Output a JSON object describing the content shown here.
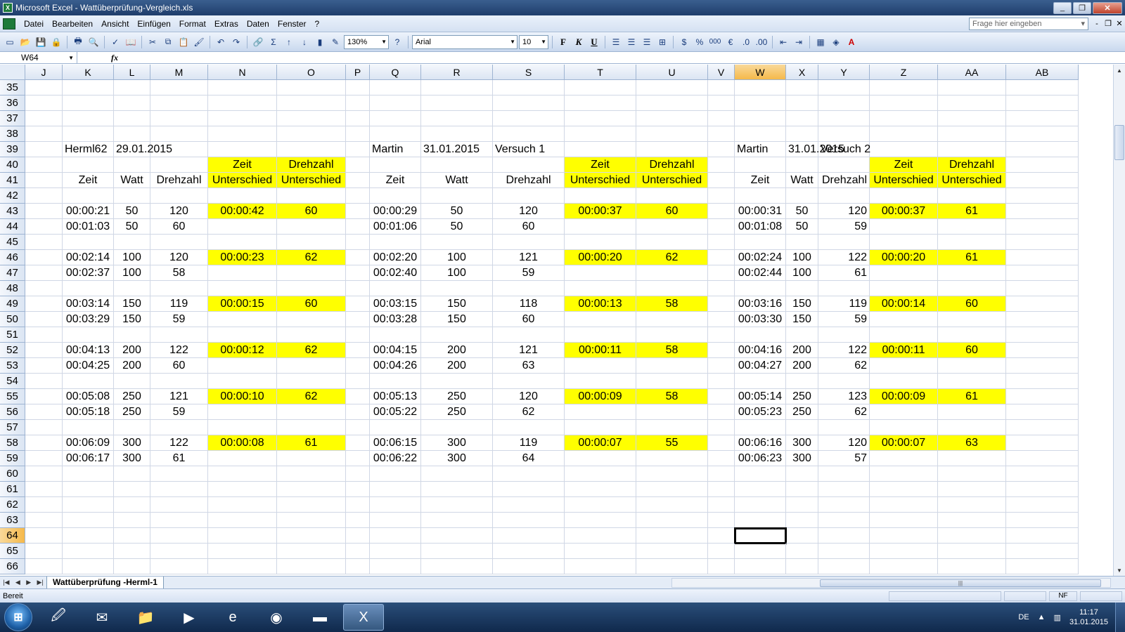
{
  "window": {
    "title": "Microsoft Excel - Wattüberprüfung-Vergleich.xls",
    "app_icon": "X",
    "buttons": [
      "_",
      "❐",
      "✕"
    ]
  },
  "menu": {
    "items": [
      "Datei",
      "Bearbeiten",
      "Ansicht",
      "Einfügen",
      "Format",
      "Extras",
      "Daten",
      "Fenster",
      "?"
    ],
    "help_placeholder": "Frage hier eingeben",
    "controls": [
      "-",
      "❐",
      "✕"
    ]
  },
  "toolbar": {
    "zoom": "130%",
    "font": "Arial",
    "size": "10",
    "bold": "F",
    "italic": "K",
    "underline": "U",
    "percent": "%",
    "thousands": "000",
    "euro": "€",
    "sum": "Σ",
    "fontcolor": "A"
  },
  "formula": {
    "namebox": "W64",
    "fx": "fx",
    "value": ""
  },
  "columns": [
    "J",
    "K",
    "L",
    "M",
    "N",
    "O",
    "P",
    "Q",
    "R",
    "S",
    "T",
    "U",
    "V",
    "W",
    "X",
    "Y",
    "Z",
    "AA",
    "AB"
  ],
  "active_column": "W",
  "active_row": "64",
  "rows": [
    {
      "n": "35",
      "cells": {}
    },
    {
      "n": "36",
      "cells": {}
    },
    {
      "n": "37",
      "cells": {}
    },
    {
      "n": "38",
      "cells": {}
    },
    {
      "n": "39",
      "cells": {
        "K": "Herml62",
        "L": "29.01.2015",
        "Q": "Martin",
        "R": "31.01.2015",
        "S": "Versuch 1",
        "W": "Martin",
        "X": "31.01.2015",
        "Y": "Versuch 2"
      }
    },
    {
      "n": "40",
      "cells": {
        "N": "Zeit",
        "O": "Drehzahl",
        "T": "Zeit",
        "U": "Drehzahl",
        "Z": "Zeit",
        "AA": "Drehzahl"
      }
    },
    {
      "n": "41",
      "cells": {
        "K": "Zeit",
        "L": "Watt",
        "M": "Drehzahl",
        "N": "Unterschied",
        "O": "Unterschied",
        "Q": "Zeit",
        "R": "Watt",
        "S": "Drehzahl",
        "T": "Unterschied",
        "U": "Unterschied",
        "W": "Zeit",
        "X": "Watt",
        "Y": "Drehzahl",
        "Z": "Unterschied",
        "AA": "Unterschied"
      }
    },
    {
      "n": "42",
      "cells": {}
    },
    {
      "n": "43",
      "cells": {
        "K": "00:00:21",
        "L": "50",
        "M": "120",
        "N": "00:00:42",
        "O": "60",
        "Q": "00:00:29",
        "R": "50",
        "S": "120",
        "T": "00:00:37",
        "U": "60",
        "W": "00:00:31",
        "X": "50",
        "Y": "120",
        "Z": "00:00:37",
        "AA": "61"
      }
    },
    {
      "n": "44",
      "cells": {
        "K": "00:01:03",
        "L": "50",
        "M": "60",
        "Q": "00:01:06",
        "R": "50",
        "S": "60",
        "W": "00:01:08",
        "X": "50",
        "Y": "59"
      }
    },
    {
      "n": "45",
      "cells": {}
    },
    {
      "n": "46",
      "cells": {
        "K": "00:02:14",
        "L": "100",
        "M": "120",
        "N": "00:00:23",
        "O": "62",
        "Q": "00:02:20",
        "R": "100",
        "S": "121",
        "T": "00:00:20",
        "U": "62",
        "W": "00:02:24",
        "X": "100",
        "Y": "122",
        "Z": "00:00:20",
        "AA": "61"
      }
    },
    {
      "n": "47",
      "cells": {
        "K": "00:02:37",
        "L": "100",
        "M": "58",
        "Q": "00:02:40",
        "R": "100",
        "S": "59",
        "W": "00:02:44",
        "X": "100",
        "Y": "61"
      }
    },
    {
      "n": "48",
      "cells": {}
    },
    {
      "n": "49",
      "cells": {
        "K": "00:03:14",
        "L": "150",
        "M": "119",
        "N": "00:00:15",
        "O": "60",
        "Q": "00:03:15",
        "R": "150",
        "S": "118",
        "T": "00:00:13",
        "U": "58",
        "W": "00:03:16",
        "X": "150",
        "Y": "119",
        "Z": "00:00:14",
        "AA": "60"
      }
    },
    {
      "n": "50",
      "cells": {
        "K": "00:03:29",
        "L": "150",
        "M": "59",
        "Q": "00:03:28",
        "R": "150",
        "S": "60",
        "W": "00:03:30",
        "X": "150",
        "Y": "59"
      }
    },
    {
      "n": "51",
      "cells": {}
    },
    {
      "n": "52",
      "cells": {
        "K": "00:04:13",
        "L": "200",
        "M": "122",
        "N": "00:00:12",
        "O": "62",
        "Q": "00:04:15",
        "R": "200",
        "S": "121",
        "T": "00:00:11",
        "U": "58",
        "W": "00:04:16",
        "X": "200",
        "Y": "122",
        "Z": "00:00:11",
        "AA": "60"
      }
    },
    {
      "n": "53",
      "cells": {
        "K": "00:04:25",
        "L": "200",
        "M": "60",
        "Q": "00:04:26",
        "R": "200",
        "S": "63",
        "W": "00:04:27",
        "X": "200",
        "Y": "62"
      }
    },
    {
      "n": "54",
      "cells": {}
    },
    {
      "n": "55",
      "cells": {
        "K": "00:05:08",
        "L": "250",
        "M": "121",
        "N": "00:00:10",
        "O": "62",
        "Q": "00:05:13",
        "R": "250",
        "S": "120",
        "T": "00:00:09",
        "U": "58",
        "W": "00:05:14",
        "X": "250",
        "Y": "123",
        "Z": "00:00:09",
        "AA": "61"
      }
    },
    {
      "n": "56",
      "cells": {
        "K": "00:05:18",
        "L": "250",
        "M": "59",
        "Q": "00:05:22",
        "R": "250",
        "S": "62",
        "W": "00:05:23",
        "X": "250",
        "Y": "62"
      }
    },
    {
      "n": "57",
      "cells": {}
    },
    {
      "n": "58",
      "cells": {
        "K": "00:06:09",
        "L": "300",
        "M": "122",
        "N": "00:00:08",
        "O": "61",
        "Q": "00:06:15",
        "R": "300",
        "S": "119",
        "T": "00:00:07",
        "U": "55",
        "W": "00:06:16",
        "X": "300",
        "Y": "120",
        "Z": "00:00:07",
        "AA": "63"
      }
    },
    {
      "n": "59",
      "cells": {
        "K": "00:06:17",
        "L": "300",
        "M": "61",
        "Q": "00:06:22",
        "R": "300",
        "S": "64",
        "W": "00:06:23",
        "X": "300",
        "Y": "57"
      }
    },
    {
      "n": "60",
      "cells": {}
    },
    {
      "n": "61",
      "cells": {}
    },
    {
      "n": "62",
      "cells": {}
    },
    {
      "n": "63",
      "cells": {}
    },
    {
      "n": "64",
      "cells": {}
    },
    {
      "n": "65",
      "cells": {}
    },
    {
      "n": "66",
      "cells": {}
    }
  ],
  "highlight_color": "#ffff00",
  "sheet_tab": "Wattüberprüfung -Herml-1",
  "status": {
    "text": "Bereit",
    "nf": "NF"
  },
  "taskbar": {
    "lang": "DE",
    "time": "11:17",
    "date": "31.01.2015",
    "apps": [
      "explorer-icon",
      "outlook-icon",
      "folder-icon",
      "media-icon",
      "ie-icon",
      "firefox-icon",
      "app-icon",
      "excel-icon"
    ]
  }
}
